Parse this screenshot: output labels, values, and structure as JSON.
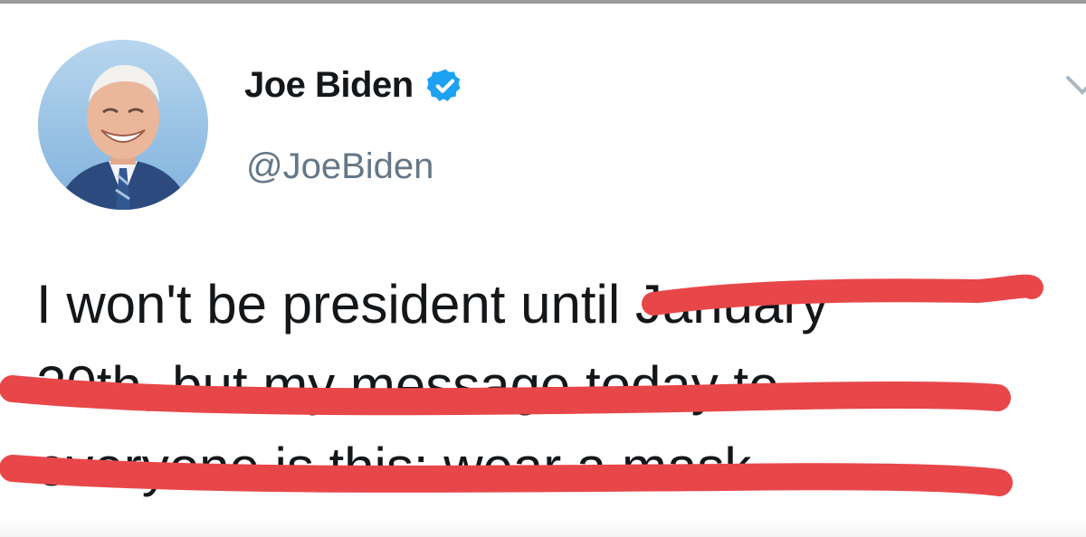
{
  "tweet": {
    "author": {
      "display_name": "Joe Biden",
      "handle": "@JoeBiden",
      "verified": true,
      "avatar_icon": "profile-photo"
    },
    "text_lines": [
      "I won't be president until January",
      "20th, but my message today to",
      "everyone is this: wear a mask."
    ],
    "struck_through": [
      "until January",
      "20th, but my message today to",
      "everyone is this: wear a mask."
    ],
    "colors": {
      "text": "#14171a",
      "handle": "#657786",
      "verified_badge": "#1da1f2",
      "strike_marker": "#e8474a"
    },
    "menu_icon": "chevron-down-icon"
  }
}
